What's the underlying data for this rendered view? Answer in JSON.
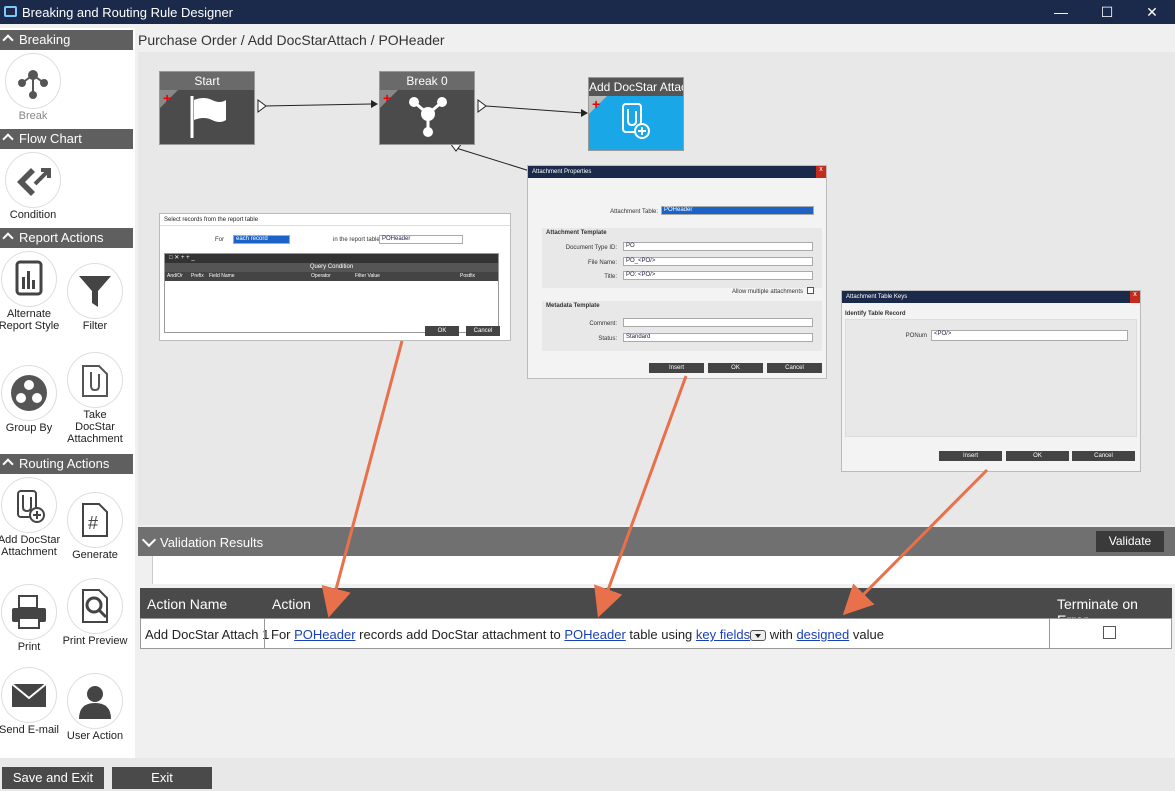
{
  "window": {
    "title": "Breaking and Routing Rule Designer",
    "min_icon": "minimize-icon",
    "max_icon": "maximize-icon",
    "close_icon": "close-icon"
  },
  "breadcrumb": "Purchase Order / Add DocStarAttach / POHeader",
  "sidebar": {
    "sections": [
      {
        "title": "Breaking",
        "tools": [
          {
            "label": "Break",
            "icon": "break-node-icon"
          }
        ]
      },
      {
        "title": "Flow Chart",
        "tools": [
          {
            "label": "Condition",
            "icon": "condition-icon"
          }
        ]
      },
      {
        "title": "Report Actions",
        "tools": [
          {
            "label": "Alternate Report Style",
            "icon": "report-style-icon"
          },
          {
            "label": "Filter",
            "icon": "filter-icon"
          },
          {
            "label": "Group By",
            "icon": "group-by-icon"
          },
          {
            "label": "Take DocStar Attachment",
            "icon": "take-attachment-icon"
          }
        ]
      },
      {
        "title": "Routing Actions",
        "tools": [
          {
            "label": "Add DocStar Attachment",
            "icon": "add-attachment-icon"
          },
          {
            "label": "Generate",
            "icon": "generate-icon"
          },
          {
            "label": "Print",
            "icon": "printer-icon"
          },
          {
            "label": "Print Preview",
            "icon": "print-preview-icon"
          },
          {
            "label": "Send E-mail",
            "icon": "envelope-icon"
          },
          {
            "label": "User Action",
            "icon": "user-icon"
          }
        ]
      }
    ]
  },
  "flow": {
    "nodes": [
      {
        "label": "Start",
        "icon": "flag-icon"
      },
      {
        "label": "Break 0",
        "icon": "break-node-icon"
      },
      {
        "label": "Add DocStar Attac",
        "icon": "add-attachment-icon"
      }
    ]
  },
  "dialog_select": {
    "title": "Select records from the report table",
    "for_label": "For",
    "for_value": "each record",
    "table_label": "in the report table",
    "table_value": "POHeader",
    "query_label": "Query Condition",
    "columns": [
      "And/Or",
      "Prefix",
      "Field Name",
      "Operator",
      "Filter Value",
      "Postfix"
    ],
    "ok": "OK",
    "cancel": "Cancel"
  },
  "dialog_attach": {
    "title": "Attachment Properties",
    "table_label": "Attachment Table:",
    "table_value": "POHeader",
    "template_section": "Attachment Template",
    "doc_type_label": "Document Type ID:",
    "doc_type_value": "PO",
    "file_name_label": "File Name:",
    "file_name_value": "PO_<PO/>",
    "title_label": "Title:",
    "title_value": "PO: <PO/>",
    "allow_multiple": "Allow multiple attachments",
    "metadata_section": "Metadata Template",
    "comment_label": "Comment:",
    "comment_value": "",
    "status_label": "Status:",
    "status_value": "Standard",
    "insert": "Insert",
    "ok": "OK",
    "cancel": "Cancel"
  },
  "dialog_keys": {
    "title": "Attachment Table Keys",
    "section": "Identify Table Record",
    "field_label": "PONum",
    "field_value": "<PO/>",
    "insert": "Insert",
    "ok": "OK",
    "cancel": "Cancel"
  },
  "validation": {
    "title": "Validation Results",
    "validate_button": "Validate"
  },
  "results": {
    "columns": [
      "Action Name",
      "Action",
      "Terminate on Error"
    ],
    "rows": [
      {
        "name": "Add DocStar Attach 1",
        "t1": "For ",
        "l1": "POHeader",
        "t2": " records add DocStar attachment to ",
        "l2": "POHeader",
        "t3": " table using ",
        "l3": "key fields",
        "t4": " with ",
        "l4": "designed",
        "t5": " value",
        "terminate": false
      }
    ]
  },
  "footer": {
    "save_exit": "Save and Exit",
    "exit": "Exit"
  },
  "colors": {
    "titlebar": "#1b2a4a",
    "node": "#4b4b4b",
    "node_active": "#1aa7e8",
    "arrow": "#e8704a",
    "link": "#1a3fb5"
  }
}
